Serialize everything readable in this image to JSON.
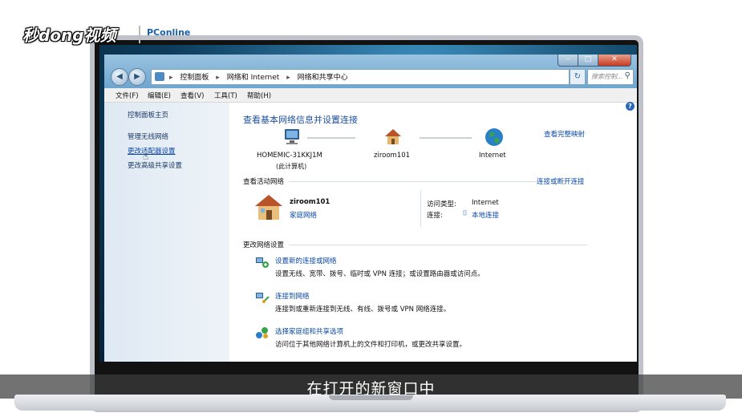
{
  "watermark": {
    "brand": "秒dong视频",
    "partner": "PConline"
  },
  "window": {
    "address_crumbs": [
      "控制面板",
      "网络和 Internet",
      "网络和共享中心"
    ],
    "search_placeholder": "搜索控制..."
  },
  "menu": [
    "文件(F)",
    "编辑(E)",
    "查看(V)",
    "工具(T)",
    "帮助(H)"
  ],
  "sidebar": {
    "home": "控制面板主页",
    "items": [
      "管理无线网络",
      "更改适配器设置",
      "更改高级共享设置"
    ]
  },
  "main": {
    "title": "查看基本网络信息并设置连接",
    "full_map_link": "查看完整映射",
    "nodes": [
      {
        "name": "HOMEMIC-31KKJ1M",
        "sub": "(此计算机)"
      },
      {
        "name": "ziroom101",
        "sub": ""
      },
      {
        "name": "Internet",
        "sub": ""
      }
    ],
    "active_header": "查看活动网络",
    "connect_disconnect_link": "连接或断开连接",
    "network": {
      "name": "ziroom101",
      "type": "家庭网络",
      "access_label": "访问类型:",
      "access_value": "Internet",
      "conn_label": "连接:",
      "conn_value": "本地连接"
    },
    "change_header": "更改网络设置",
    "tasks": [
      {
        "title": "设置新的连接或网络",
        "desc": "设置无线、宽带、拨号、临时或 VPN 连接；或设置路由器或访问点。"
      },
      {
        "title": "连接到网络",
        "desc": "连接到或重新连接到无线、有线、拨号或 VPN 网络连接。"
      },
      {
        "title": "选择家庭组和共享选项",
        "desc": "访问位于其他网络计算机上的文件和打印机，或更改共享设置。"
      }
    ]
  },
  "subtitle": "在打开的新窗口中"
}
